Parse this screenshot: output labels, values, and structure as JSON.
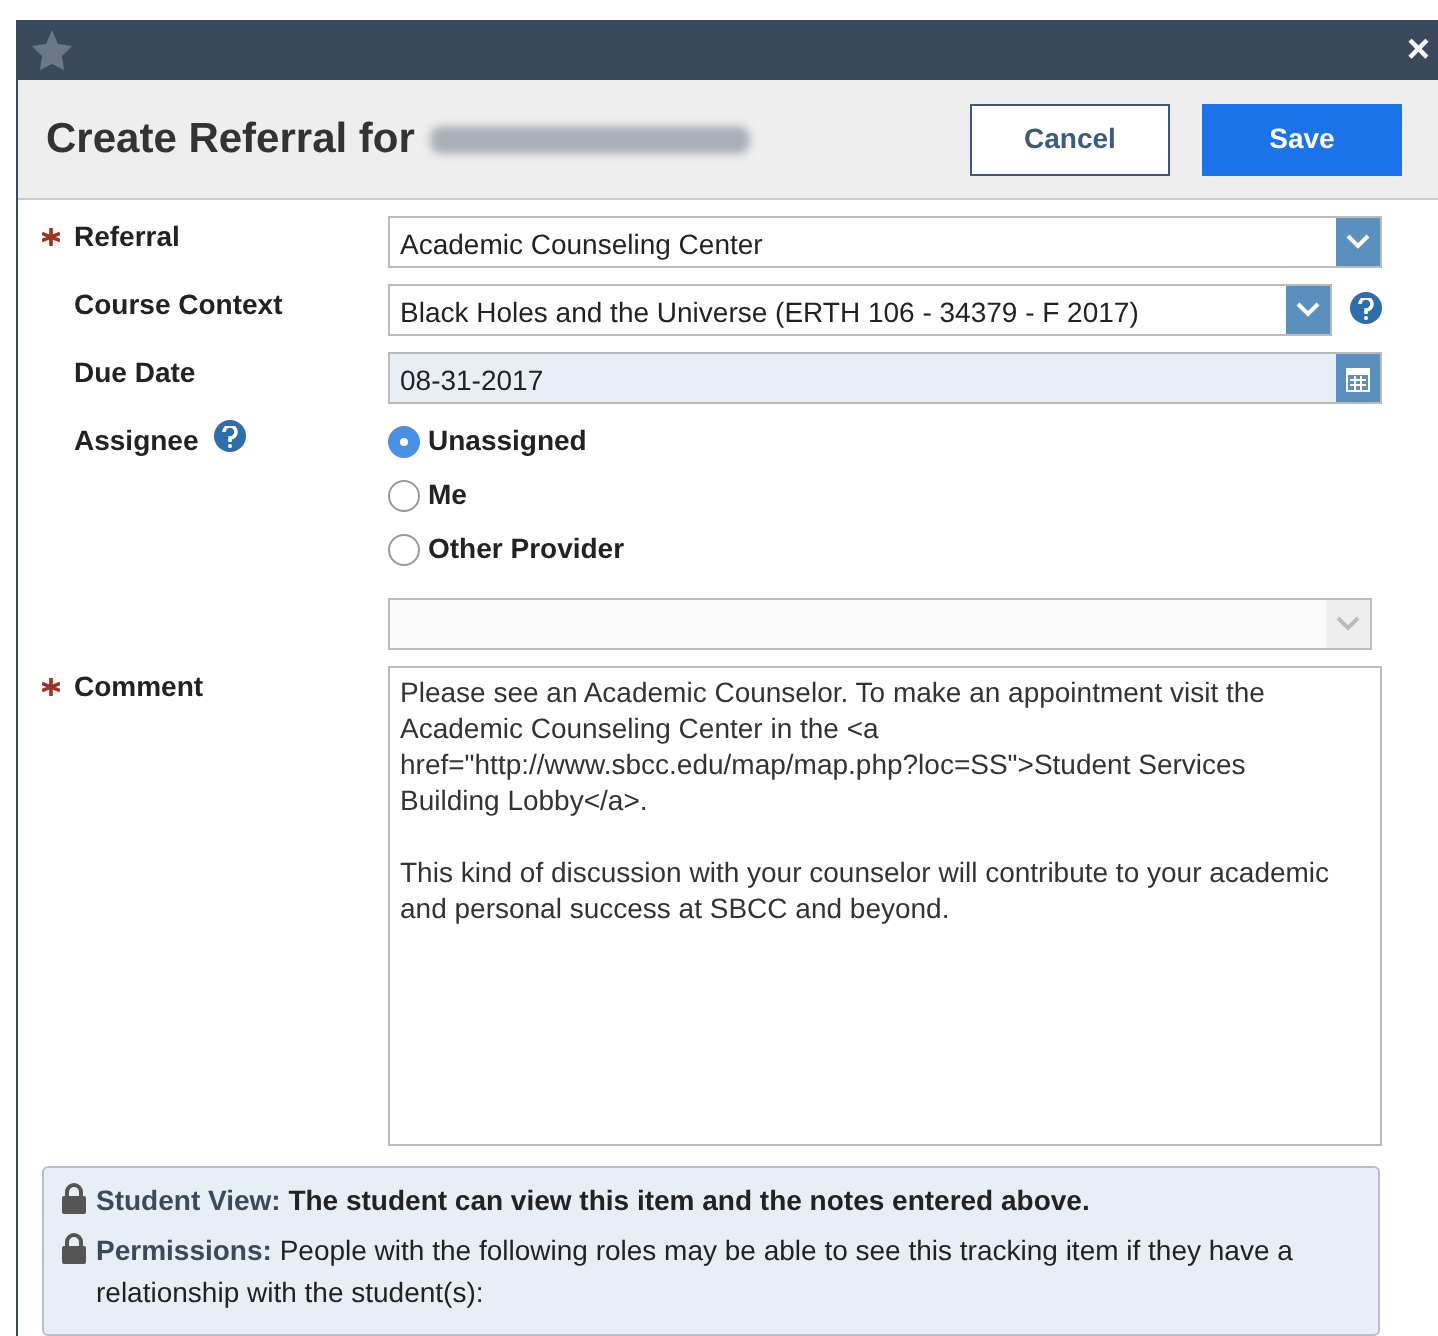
{
  "window": {
    "close": "×"
  },
  "header": {
    "title": "Create Referral for",
    "buttons": [
      {
        "label": "Cancel",
        "kind": "secondary"
      },
      {
        "label": "Save",
        "kind": "primary"
      }
    ]
  },
  "fields": [
    {
      "kind": "select",
      "label": "Referral",
      "required": true,
      "value": "Academic Counseling Center",
      "help": false
    },
    {
      "kind": "select",
      "label": "Course Context",
      "required": false,
      "value": "Black Holes and the Universe (ERTH 106 - 34379 - F 2017)",
      "help": true
    },
    {
      "kind": "date",
      "label": "Due Date",
      "required": false,
      "value": "08-31-2017",
      "help": false
    },
    {
      "kind": "radios",
      "label": "Assignee",
      "required": false,
      "help": true,
      "options": [
        {
          "label": "Unassigned",
          "selected": true
        },
        {
          "label": "Me",
          "selected": false
        },
        {
          "label": "Other Provider",
          "selected": false
        }
      ],
      "provider_select": {
        "disabled": true
      }
    },
    {
      "kind": "textarea",
      "label": "Comment",
      "required": true,
      "help": false,
      "value": "Please see an Academic Counselor. To make an appointment visit the Academic Counseling Center in the <a href=\"http://www.sbcc.edu/map/map.php?loc=SS\">Student Services Building Lobby</a>.\n\nThis kind of discussion with your counselor will contribute to your academic and personal success at SBCC and beyond."
    }
  ],
  "notices": [
    {
      "label": "Student View:",
      "text": "The student can view this item and the notes entered above.",
      "bold": true
    },
    {
      "label": "Permissions:",
      "text": "People with the following roles may be able to see this tracking item if they have a relationship with the student(s):",
      "bold": false
    }
  ]
}
